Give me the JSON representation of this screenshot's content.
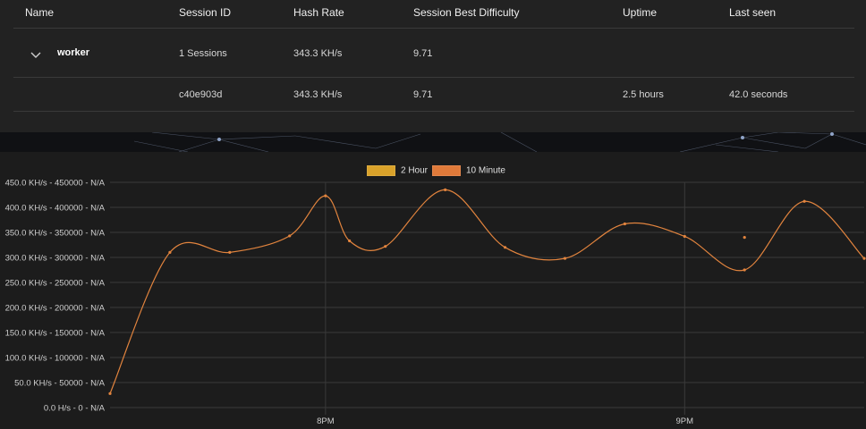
{
  "table": {
    "headers": {
      "name": "Name",
      "session_id": "Session ID",
      "hash_rate": "Hash Rate",
      "best_difficulty": "Session Best Difficulty",
      "uptime": "Uptime",
      "last_seen": "Last seen"
    },
    "worker_row": {
      "name": "worker",
      "session_id": "1 Sessions",
      "hash_rate": "343.3 KH/s",
      "best_difficulty": "9.71",
      "uptime": "",
      "last_seen": ""
    },
    "session_row": {
      "name": "",
      "session_id": "c40e903d",
      "hash_rate": "343.3 KH/s",
      "best_difficulty": "9.71",
      "uptime": "2.5 hours",
      "last_seen": "42.0 seconds"
    }
  },
  "legend": {
    "two_hour": "2 Hour",
    "ten_minute": "10 Minute"
  },
  "colors": {
    "two_hour": "#d9a22a",
    "ten_minute": "#e07a3a",
    "line": "#e2843e"
  },
  "chart_data": {
    "type": "line",
    "title": "",
    "xlabel": "",
    "ylabel": "",
    "ylim": [
      0,
      450000
    ],
    "y_ticks": [
      0,
      50000,
      100000,
      150000,
      200000,
      250000,
      300000,
      350000,
      400000,
      450000
    ],
    "y_tick_labels": [
      "0.0 H/s - 0 - N/A",
      "50.0 KH/s - 50000 - N/A",
      "100.0 KH/s - 100000 - N/A",
      "150.0 KH/s - 150000 - N/A",
      "200.0 KH/s - 200000 - N/A",
      "250.0 KH/s - 250000 - N/A",
      "300.0 KH/s - 300000 - N/A",
      "350.0 KH/s - 350000 - N/A",
      "400.0 KH/s - 400000 - N/A",
      "450.0 KH/s - 450000 - N/A"
    ],
    "x_range": [
      "19:24",
      "21:30"
    ],
    "x_ticks": [
      "20:00",
      "21:00"
    ],
    "x_tick_labels": [
      "8PM",
      "9PM"
    ],
    "legend_position": "top-center",
    "grid": true,
    "series": [
      {
        "name": "10 Minute",
        "x": [
          "19:24",
          "19:34",
          "19:44",
          "19:54",
          "20:04",
          "20:00",
          "20:10",
          "20:20",
          "20:30",
          "20:40",
          "20:50",
          "21:00",
          "21:10",
          "21:20",
          "21:30"
        ],
        "values": [
          28000,
          310000,
          310000,
          343000,
          333000,
          423000,
          322000,
          435000,
          320000,
          298000,
          367000,
          342000,
          275000,
          412000,
          298000
        ]
      },
      {
        "name": "2 Hour",
        "x": [
          "21:10"
        ],
        "values": [
          340000
        ]
      }
    ]
  }
}
